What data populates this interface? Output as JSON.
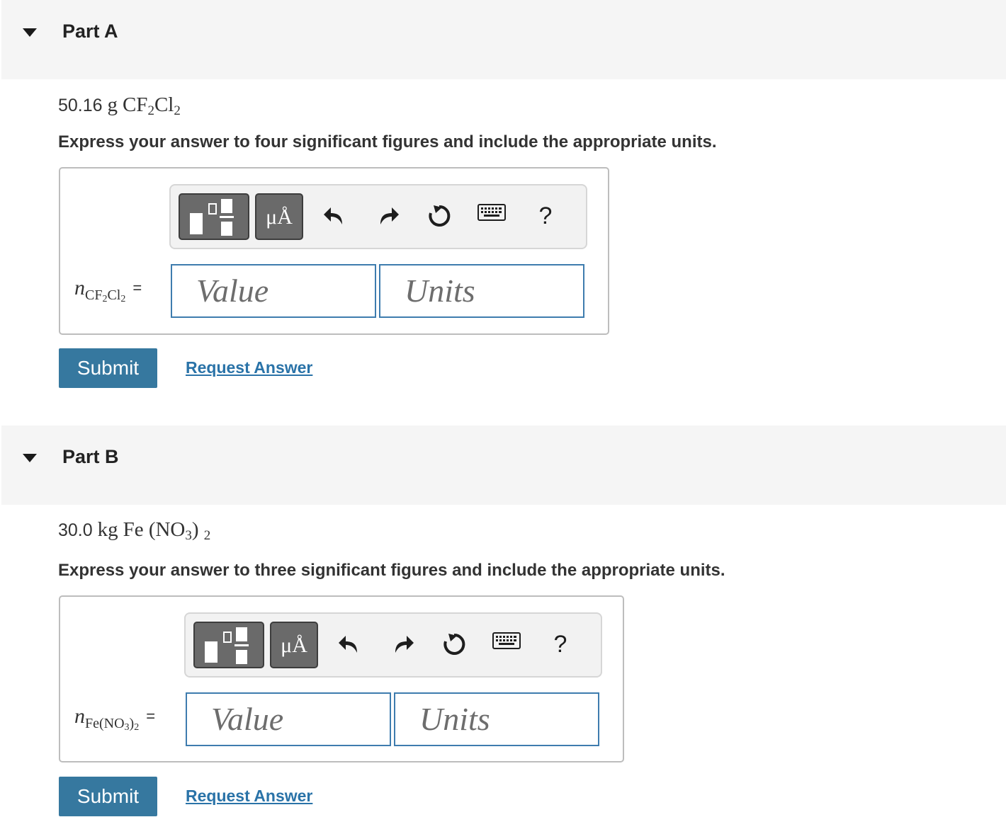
{
  "parts": [
    {
      "title": "Part A",
      "given_mass": "50.16",
      "given_unit": "g",
      "formula_main": "CF",
      "formula_sub1": "2",
      "formula_mid": "Cl",
      "formula_sub2": "2",
      "instruction": "Express your answer to four significant figures and include the appropriate units.",
      "var_symbol": "n",
      "var_sub_a": "CF",
      "var_sub_a2": "2",
      "var_sub_b": "Cl",
      "var_sub_b2": "2",
      "equals": "=",
      "value_placeholder": "Value",
      "units_placeholder": "Units",
      "submit_label": "Submit",
      "request_label": "Request Answer"
    },
    {
      "title": "Part B",
      "given_mass": "30.0",
      "given_unit": "kg",
      "formula_main": "Fe (NO",
      "formula_sub1": "3",
      "formula_mid": ")",
      "formula_sub2": "2",
      "instruction": "Express your answer to three significant figures and include the appropriate units.",
      "var_symbol": "n",
      "var_sub_a": "Fe(NO",
      "var_sub_a2": "3",
      "var_sub_b": ")",
      "var_sub_b2": "2",
      "equals": "=",
      "value_placeholder": "Value",
      "units_placeholder": "Units",
      "submit_label": "Submit",
      "request_label": "Request Answer"
    }
  ],
  "toolbar": {
    "units_button_label": "μÅ",
    "help_label": "?",
    "icons": [
      "templates-icon",
      "units-icon",
      "undo-icon",
      "redo-icon",
      "reset-icon",
      "keyboard-icon",
      "help-icon"
    ]
  },
  "colors": {
    "header_bg": "#f5f5f5",
    "input_border": "#3e7cae",
    "submit_bg": "#36789f",
    "link": "#2a73a8",
    "toolbar_button": "#6a6a6a"
  }
}
